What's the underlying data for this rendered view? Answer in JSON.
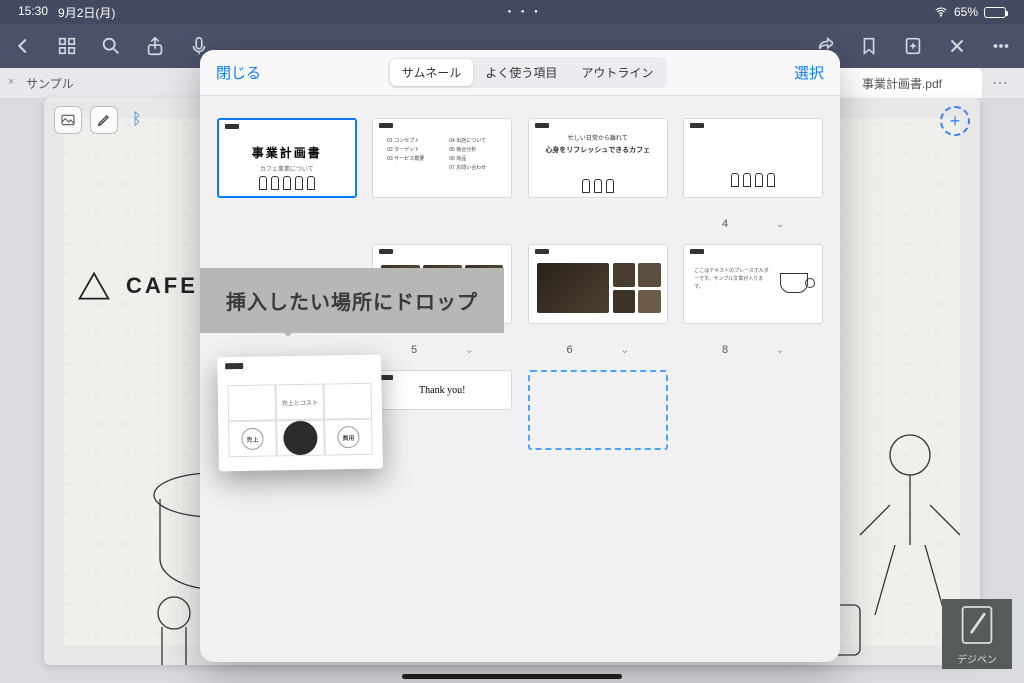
{
  "status": {
    "time": "15:30",
    "date": "9月2日(月)",
    "battery": "65%"
  },
  "tabs": {
    "left": "サンプル",
    "right": "事業計画書.pdf"
  },
  "canvas": {
    "logo_text": "CAFE"
  },
  "popover": {
    "close": "閉じる",
    "select": "選択",
    "segments": {
      "thumb": "サムネール",
      "fav": "よく使う項目",
      "outline": "アウトライン"
    },
    "pages": {
      "p4": "4",
      "p5": "5",
      "p6": "6",
      "p8": "8"
    }
  },
  "thumbs": {
    "t1_title": "事業計画書",
    "t1_sub": "カフェ事業について",
    "t2_items": [
      "01 コンセプト",
      "02 ターゲット",
      "03 サービス概要",
      "04 出店について",
      "05 競合分析",
      "06 商品",
      "07 お問い合わせ"
    ],
    "t3_a": "忙しい日常から離れて",
    "t3_b": "心身をリフレッシュできるカフェ"
  },
  "callout": "挿入したい場所にドロップ",
  "watermark": "デジペン"
}
